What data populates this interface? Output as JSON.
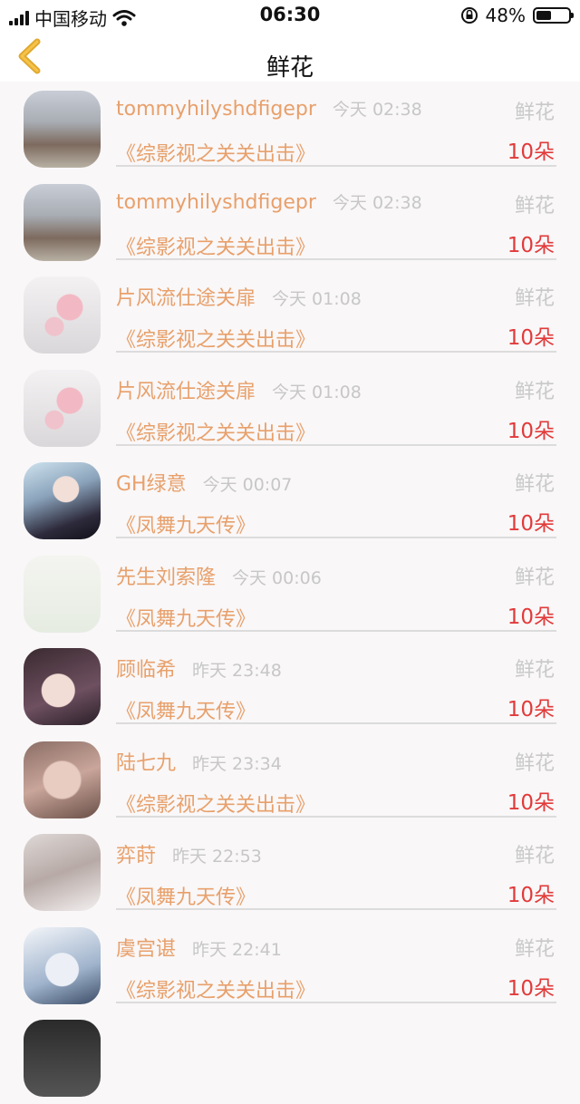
{
  "status": {
    "carrier": "中国移动",
    "time": "06:30",
    "battery": "48%",
    "battery_level": 0.48
  },
  "nav": {
    "title": "鲜花"
  },
  "colors": {
    "accent": "#e8a06b",
    "count": "#e23a3a",
    "back": "#e0a82e"
  },
  "rows": [
    {
      "name": "tommyhilyshdfigepr",
      "time": "今天 02:38",
      "gift": "鲜花",
      "book": "《综影视之关关出击》",
      "count": "10朵",
      "avatar": "guard"
    },
    {
      "name": "tommyhilyshdfigepr",
      "time": "今天 02:38",
      "gift": "鲜花",
      "book": "《综影视之关关出击》",
      "count": "10朵",
      "avatar": "guard"
    },
    {
      "name": "片风流仕途关扉",
      "time": "今天 01:08",
      "gift": "鲜花",
      "book": "《综影视之关关出击》",
      "count": "10朵",
      "avatar": "roses"
    },
    {
      "name": "片风流仕途关扉",
      "time": "今天 01:08",
      "gift": "鲜花",
      "book": "《综影视之关关出击》",
      "count": "10朵",
      "avatar": "roses"
    },
    {
      "name": "GH绿意",
      "time": "今天 00:07",
      "gift": "鲜花",
      "book": "《凤舞九天传》",
      "count": "10朵",
      "avatar": "anime-dark"
    },
    {
      "name": "先生刘索隆",
      "time": "今天 00:06",
      "gift": "鲜花",
      "book": "《凤舞九天传》",
      "count": "10朵",
      "avatar": "sketch"
    },
    {
      "name": "顾临希",
      "time": "昨天 23:48",
      "gift": "鲜花",
      "book": "《凤舞九天传》",
      "count": "10朵",
      "avatar": "anime-girl"
    },
    {
      "name": "陆七九",
      "time": "昨天 23:34",
      "gift": "鲜花",
      "book": "《综影视之关关出击》",
      "count": "10朵",
      "avatar": "photo-girl"
    },
    {
      "name": "弈莳",
      "time": "昨天 22:53",
      "gift": "鲜花",
      "book": "《凤舞九天传》",
      "count": "10朵",
      "avatar": "photo-soft"
    },
    {
      "name": "虞宫谌",
      "time": "昨天 22:41",
      "gift": "鲜花",
      "book": "《综影视之关关出击》",
      "count": "10朵",
      "avatar": "anime-sketch"
    }
  ]
}
